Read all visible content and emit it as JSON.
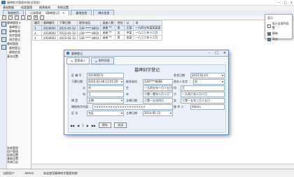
{
  "app": {
    "title": "墓碑刻字管理系统(试用版)",
    "window_buttons": [
      "—",
      "□",
      "✕"
    ]
  },
  "menu": [
    "基础数据",
    "档案管理",
    "报表查询",
    "系统设置"
  ],
  "tabs": [
    {
      "label": "系统首页",
      "active": false
    },
    {
      "label": "记录管理 - 【墓碑登记】",
      "active": true
    },
    {
      "label": "墓地信息",
      "active": false
    },
    {
      "label": "碑文信息",
      "active": false
    }
  ],
  "sidebar": {
    "tree": [
      "墓碑管理 ▾",
      "墓碑登记",
      "墓碑查询",
      "刻字管理",
      "刻字登记",
      "墓地管理",
      "墓地登记",
      "墓地信息",
      "基本设置"
    ],
    "bottom": [
      "系统管理",
      "用户管理",
      "权限设置",
      "基础设置",
      "系统日志"
    ]
  },
  "table": {
    "headers": [
      "编号",
      "墓碑编号",
      "下葬日期",
      "联系电话",
      "逝者人数",
      "性别",
      "父",
      "母"
    ],
    "rows": [
      [
        "1",
        "2019001",
        "2015-02-12",
        "139 **** 8001",
        "逝者 **",
        "男",
        "王某",
        "一九四五年某某某某"
      ],
      [
        "2",
        "2019002",
        "2015-02-12",
        "139 **** 8002",
        "逝者 **",
        "女",
        "李某",
        "一九二八年十二月"
      ],
      [
        "3",
        "2019003",
        "2015-02-12",
        "139 **** 8003",
        "逝者 **",
        "男",
        "张某",
        "一九三二年十二月"
      ]
    ]
  },
  "popup": {
    "title": "显示",
    "items": [
      {
        "label": "显示全部列设置",
        "on": false
      },
      {
        "label": "刷新",
        "on": true
      },
      {
        "label": "导出",
        "on": true
      }
    ]
  },
  "dialog": {
    "title": "墓碑登记",
    "tabs": [
      {
        "label": "信息录入"
      },
      {
        "label": "附件信息"
      }
    ],
    "form_title": "墓碑刻字登记",
    "fields": {
      "id_label": "区 编 号",
      "id_value": "2019001号",
      "order_date_label": "条合日期",
      "order_date_value": "2015-02-01",
      "bury_date_label": "下葬日期",
      "bury_date_value": "2015-02-06 12:01:00",
      "phone_label": "联系电话",
      "phone_value": "138****8888",
      "count_label": "承办人名字",
      "count_value": "刘",
      "father_label": "父",
      "father_name": "刘",
      "father_birth_label": "生",
      "father_birth_value": "一九四五年一月十五日",
      "mother_label": "母",
      "mother_name": "王",
      "mother_birth_label": "卒",
      "mother_birth_value": "二零一零年二月十日",
      "son_label": "子",
      "son_name": "刘某某",
      "son_birth_label": "生",
      "son_birth_value": "一九四六年十月十日",
      "daughter_label": "女",
      "daughter_name": "王某",
      "daughter_birth_label": "卒",
      "daughter_birth_value": "二零一五年三月十五日",
      "stele_label": "碑 型",
      "stele_value": "立碑",
      "stele_date_label": "立碑日期",
      "stele_date_value": "二零一五年四月",
      "flag_label": "标",
      "flag_value": "标",
      "inscription_label": "碑前刻字内容",
      "inscription_value": "××××××××××××××××××××××",
      "operator_label": "操 作 人",
      "operator_value": "Admin",
      "area_label": "区 位",
      "area_value": "东区",
      "reg_date_label": "立碑日期",
      "reg_date_value": "2014-05-15",
      "nav": [
        "◀◀",
        "◀",
        "1",
        "▶",
        "▶▶"
      ],
      "save_label": "保存",
      "close_label": "关闭"
    }
  },
  "status": {
    "user_label": "当前用户:",
    "user": "Admin",
    "hint": "欢迎使用墓碑刻字管理系统!"
  },
  "colors": {
    "accent": "#3a78c9",
    "dialog_border": "#6a8fbd"
  }
}
